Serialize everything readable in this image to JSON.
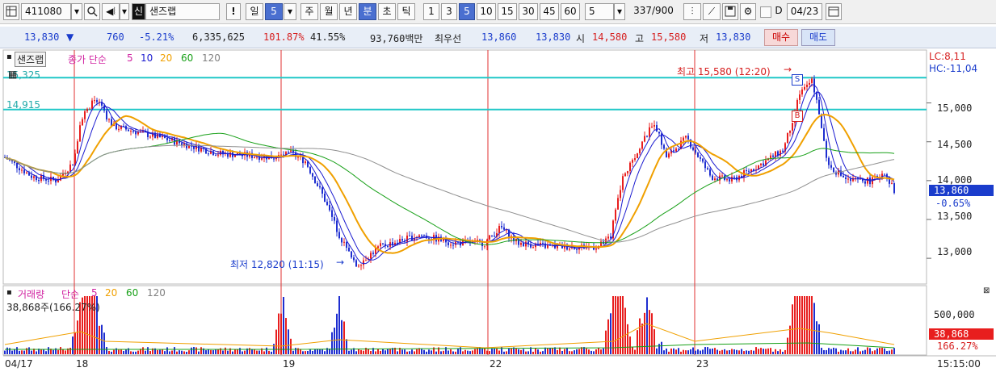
{
  "toolbar": {
    "code": "411080",
    "credit_badge": "신",
    "stock_name": "샌즈랩",
    "exclaim": "!",
    "period_buttons": [
      "일",
      "5",
      "주",
      "월",
      "년",
      "분",
      "초",
      "틱"
    ],
    "minute_buttons": [
      "1",
      "3",
      "5",
      "10",
      "15",
      "30",
      "45",
      "60"
    ],
    "count_value": "5",
    "bars_display": "337/900",
    "d_label": "D",
    "date_value": "04/23"
  },
  "info": {
    "price": "13,830",
    "change": "760",
    "change_pct": "-5.21%",
    "volume": "6,335,625",
    "vol_ratio": "101.87%",
    "turnover": "41.55%",
    "amount": "93,760백만",
    "best_label": "최우선",
    "best_ask": "13,860",
    "best_bid": "13,830",
    "open_label": "시",
    "open": "14,580",
    "high_label": "고",
    "high": "15,580",
    "low_label": "저",
    "low": "13,830",
    "buy_label": "매수",
    "sell_label": "매도"
  },
  "price_panel": {
    "title_chip": "샌즈랩",
    "legend_prefix": "종가 단순",
    "ma_periods": [
      "5",
      "10",
      "20",
      "60",
      "120"
    ],
    "ma_colors": [
      "#1b1bd0",
      "#1b1bd0",
      "#f0a000",
      "#18a018",
      "#909090"
    ],
    "hline_labels": [
      "15,325",
      "14,915"
    ],
    "lc_hc": [
      "LC:8,11",
      "HC:-11,04"
    ],
    "y_ticks": [
      "15,000",
      "14,500",
      "14,000",
      "13,500",
      "13,000"
    ],
    "current_price": "13,860",
    "current_pct": "-0.65%",
    "max_annotation": "최고 15,580 (12:20)",
    "min_annotation": "최저 12,820 (11:15)",
    "signal_s": "S",
    "signal_b": "B"
  },
  "volume_panel": {
    "legend_title": "거래량",
    "legend_prefix": "단순",
    "ma_periods": [
      "5",
      "20",
      "60",
      "120"
    ],
    "current_volume": "38,868주(166.27%)",
    "y_ticks": [
      "500,000"
    ],
    "current_badge": "38,868",
    "current_pct": "166.27%"
  },
  "x_axis": {
    "labels": [
      "04/17",
      "18",
      "19",
      "22",
      "23"
    ],
    "end_time": "15:15:00"
  },
  "colors": {
    "up": "#e81e1e",
    "down": "#1e2ed0",
    "cyan_line": "#20c8c8",
    "session_line": "#e03030"
  },
  "chart_data": {
    "type": "candlestick",
    "y_range": [
      12700,
      15650
    ],
    "horizontal_levels": [
      15325,
      14915
    ],
    "high": 15580,
    "low": 12820,
    "close": 13860,
    "sessions": [
      "04/17",
      "04/18",
      "04/19",
      "04/22",
      "04/23"
    ]
  }
}
